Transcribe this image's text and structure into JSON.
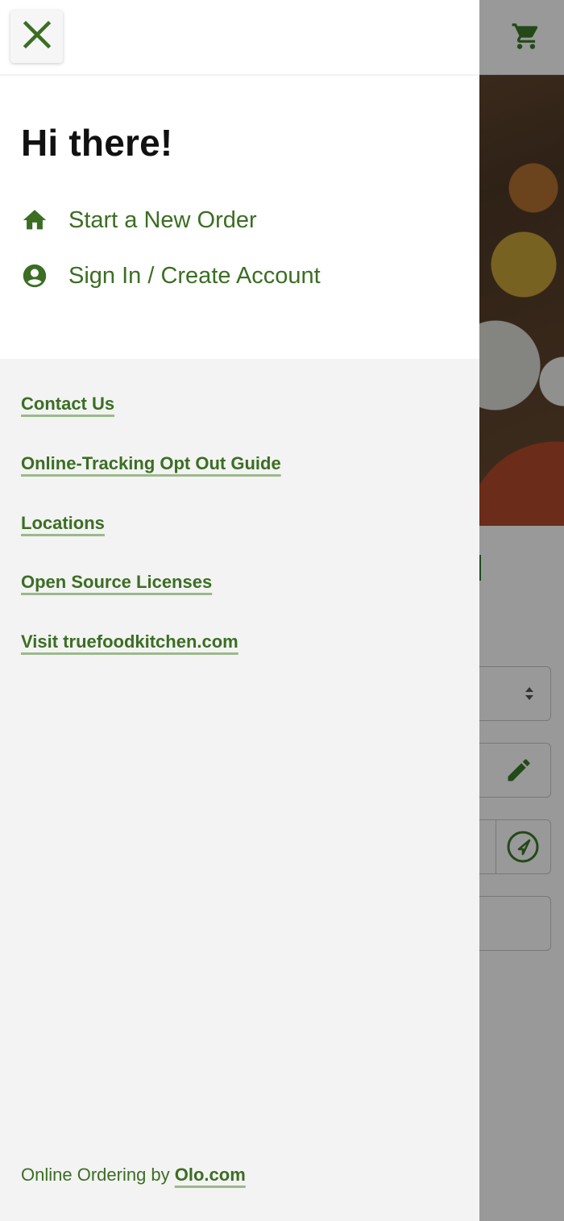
{
  "drawer": {
    "greeting": "Hi there!",
    "nav": [
      {
        "label": "Start a New Order",
        "icon": "home-icon"
      },
      {
        "label": "Sign In / Create Account",
        "icon": "user-circle-icon"
      }
    ],
    "links": [
      {
        "label": "Contact Us"
      },
      {
        "label": "Online-Tracking Opt Out Guide"
      },
      {
        "label": "Locations"
      },
      {
        "label": "Open Source Licenses"
      },
      {
        "label": "Visit truefoodkitchen.com"
      }
    ],
    "footer": {
      "prefix": "Online Ordering by",
      "link_label": "Olo.com"
    },
    "close_icon": "close-icon"
  },
  "background": {
    "cart_icon": "shopping-cart-icon",
    "select_icon": "sort-arrows-icon",
    "edit_icon": "pencil-icon",
    "locate_icon": "location-arrow-icon"
  },
  "colors": {
    "accent": "#3b6e23",
    "link_underline": "#9bb98c",
    "drawer_bg": "#f3f3f3",
    "drawer_top_bg": "#ffffff",
    "heading": "#111111"
  }
}
